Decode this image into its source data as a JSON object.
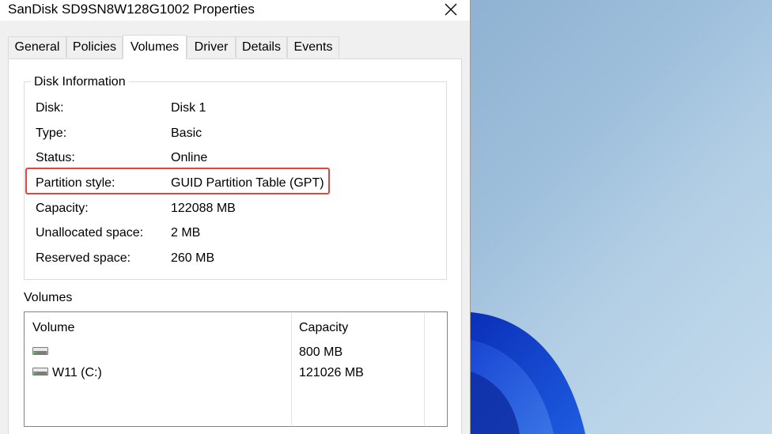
{
  "window": {
    "title": "SanDisk SD9SN8W128G1002 Properties"
  },
  "tabs": [
    {
      "label": "General",
      "active": false
    },
    {
      "label": "Policies",
      "active": false
    },
    {
      "label": "Volumes",
      "active": true
    },
    {
      "label": "Driver",
      "active": false
    },
    {
      "label": "Details",
      "active": false
    },
    {
      "label": "Events",
      "active": false
    }
  ],
  "disk_information": {
    "heading": "Disk Information",
    "rows": [
      {
        "label": "Disk:",
        "value": "Disk 1"
      },
      {
        "label": "Type:",
        "value": "Basic"
      },
      {
        "label": "Status:",
        "value": "Online"
      },
      {
        "label": "Partition style:",
        "value": "GUID Partition Table (GPT)"
      },
      {
        "label": "Capacity:",
        "value": "122088 MB"
      },
      {
        "label": "Unallocated space:",
        "value": "2 MB"
      },
      {
        "label": "Reserved space:",
        "value": "260 MB"
      }
    ]
  },
  "volumes": {
    "heading": "Volumes",
    "columns": [
      "Volume",
      "Capacity"
    ],
    "rows": [
      {
        "volume": "",
        "capacity": "800 MB",
        "icon": "drive-icon"
      },
      {
        "volume": "W11 (C:)",
        "capacity": "121026 MB",
        "icon": "drive-icon"
      }
    ]
  },
  "colors": {
    "highlight": "#e0463e",
    "wallpaper_accent": "#1a3fc4"
  }
}
